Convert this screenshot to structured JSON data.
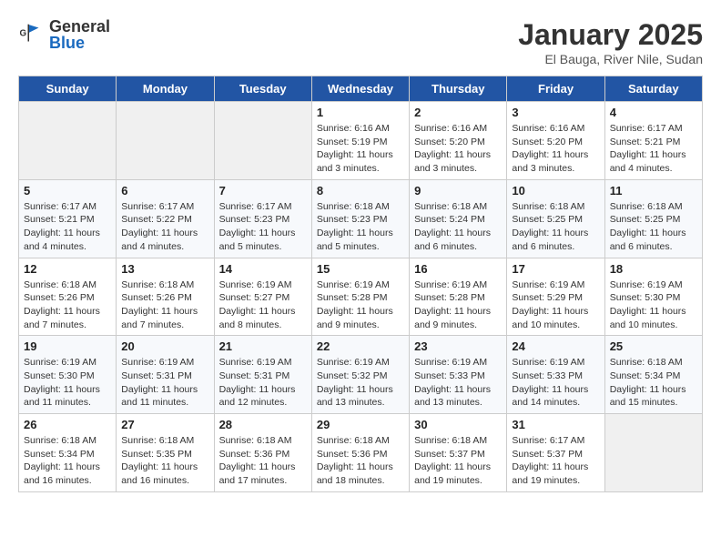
{
  "header": {
    "logo_general": "General",
    "logo_blue": "Blue",
    "title": "January 2025",
    "subtitle": "El Bauga, River Nile, Sudan"
  },
  "days_of_week": [
    "Sunday",
    "Monday",
    "Tuesday",
    "Wednesday",
    "Thursday",
    "Friday",
    "Saturday"
  ],
  "weeks": [
    [
      {
        "day": "",
        "info": ""
      },
      {
        "day": "",
        "info": ""
      },
      {
        "day": "",
        "info": ""
      },
      {
        "day": "1",
        "info": "Sunrise: 6:16 AM\nSunset: 5:19 PM\nDaylight: 11 hours\nand 3 minutes."
      },
      {
        "day": "2",
        "info": "Sunrise: 6:16 AM\nSunset: 5:20 PM\nDaylight: 11 hours\nand 3 minutes."
      },
      {
        "day": "3",
        "info": "Sunrise: 6:16 AM\nSunset: 5:20 PM\nDaylight: 11 hours\nand 3 minutes."
      },
      {
        "day": "4",
        "info": "Sunrise: 6:17 AM\nSunset: 5:21 PM\nDaylight: 11 hours\nand 4 minutes."
      }
    ],
    [
      {
        "day": "5",
        "info": "Sunrise: 6:17 AM\nSunset: 5:21 PM\nDaylight: 11 hours\nand 4 minutes."
      },
      {
        "day": "6",
        "info": "Sunrise: 6:17 AM\nSunset: 5:22 PM\nDaylight: 11 hours\nand 4 minutes."
      },
      {
        "day": "7",
        "info": "Sunrise: 6:17 AM\nSunset: 5:23 PM\nDaylight: 11 hours\nand 5 minutes."
      },
      {
        "day": "8",
        "info": "Sunrise: 6:18 AM\nSunset: 5:23 PM\nDaylight: 11 hours\nand 5 minutes."
      },
      {
        "day": "9",
        "info": "Sunrise: 6:18 AM\nSunset: 5:24 PM\nDaylight: 11 hours\nand 6 minutes."
      },
      {
        "day": "10",
        "info": "Sunrise: 6:18 AM\nSunset: 5:25 PM\nDaylight: 11 hours\nand 6 minutes."
      },
      {
        "day": "11",
        "info": "Sunrise: 6:18 AM\nSunset: 5:25 PM\nDaylight: 11 hours\nand 6 minutes."
      }
    ],
    [
      {
        "day": "12",
        "info": "Sunrise: 6:18 AM\nSunset: 5:26 PM\nDaylight: 11 hours\nand 7 minutes."
      },
      {
        "day": "13",
        "info": "Sunrise: 6:18 AM\nSunset: 5:26 PM\nDaylight: 11 hours\nand 7 minutes."
      },
      {
        "day": "14",
        "info": "Sunrise: 6:19 AM\nSunset: 5:27 PM\nDaylight: 11 hours\nand 8 minutes."
      },
      {
        "day": "15",
        "info": "Sunrise: 6:19 AM\nSunset: 5:28 PM\nDaylight: 11 hours\nand 9 minutes."
      },
      {
        "day": "16",
        "info": "Sunrise: 6:19 AM\nSunset: 5:28 PM\nDaylight: 11 hours\nand 9 minutes."
      },
      {
        "day": "17",
        "info": "Sunrise: 6:19 AM\nSunset: 5:29 PM\nDaylight: 11 hours\nand 10 minutes."
      },
      {
        "day": "18",
        "info": "Sunrise: 6:19 AM\nSunset: 5:30 PM\nDaylight: 11 hours\nand 10 minutes."
      }
    ],
    [
      {
        "day": "19",
        "info": "Sunrise: 6:19 AM\nSunset: 5:30 PM\nDaylight: 11 hours\nand 11 minutes."
      },
      {
        "day": "20",
        "info": "Sunrise: 6:19 AM\nSunset: 5:31 PM\nDaylight: 11 hours\nand 11 minutes."
      },
      {
        "day": "21",
        "info": "Sunrise: 6:19 AM\nSunset: 5:31 PM\nDaylight: 11 hours\nand 12 minutes."
      },
      {
        "day": "22",
        "info": "Sunrise: 6:19 AM\nSunset: 5:32 PM\nDaylight: 11 hours\nand 13 minutes."
      },
      {
        "day": "23",
        "info": "Sunrise: 6:19 AM\nSunset: 5:33 PM\nDaylight: 11 hours\nand 13 minutes."
      },
      {
        "day": "24",
        "info": "Sunrise: 6:19 AM\nSunset: 5:33 PM\nDaylight: 11 hours\nand 14 minutes."
      },
      {
        "day": "25",
        "info": "Sunrise: 6:18 AM\nSunset: 5:34 PM\nDaylight: 11 hours\nand 15 minutes."
      }
    ],
    [
      {
        "day": "26",
        "info": "Sunrise: 6:18 AM\nSunset: 5:34 PM\nDaylight: 11 hours\nand 16 minutes."
      },
      {
        "day": "27",
        "info": "Sunrise: 6:18 AM\nSunset: 5:35 PM\nDaylight: 11 hours\nand 16 minutes."
      },
      {
        "day": "28",
        "info": "Sunrise: 6:18 AM\nSunset: 5:36 PM\nDaylight: 11 hours\nand 17 minutes."
      },
      {
        "day": "29",
        "info": "Sunrise: 6:18 AM\nSunset: 5:36 PM\nDaylight: 11 hours\nand 18 minutes."
      },
      {
        "day": "30",
        "info": "Sunrise: 6:18 AM\nSunset: 5:37 PM\nDaylight: 11 hours\nand 19 minutes."
      },
      {
        "day": "31",
        "info": "Sunrise: 6:17 AM\nSunset: 5:37 PM\nDaylight: 11 hours\nand 19 minutes."
      },
      {
        "day": "",
        "info": ""
      }
    ]
  ]
}
